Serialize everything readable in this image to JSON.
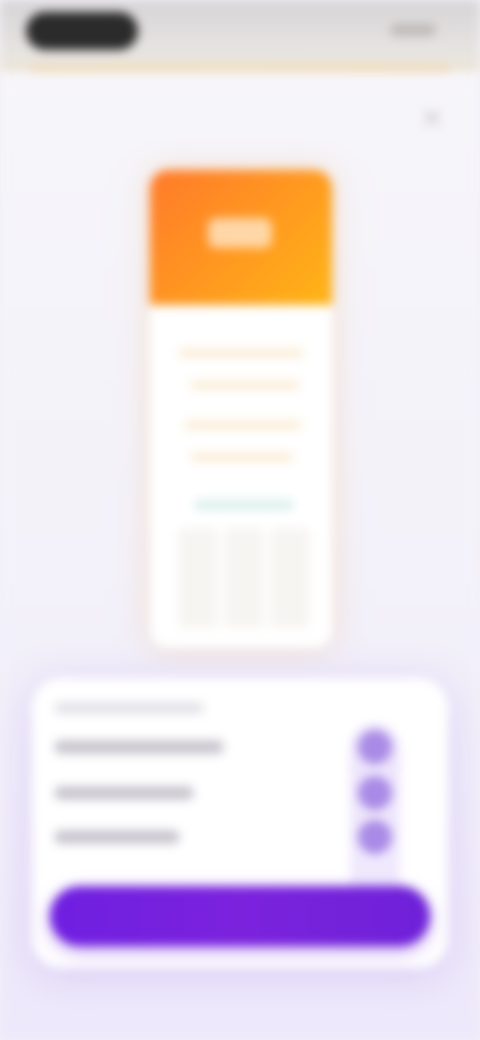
{
  "status_bar": {
    "time": ""
  },
  "close": {
    "icon": "close-icon"
  },
  "colors": {
    "accent": "#7322de",
    "mock_header_start": "#ff7a2a",
    "mock_header_end": "#ffb516"
  },
  "panel": {
    "continue_label": ""
  }
}
